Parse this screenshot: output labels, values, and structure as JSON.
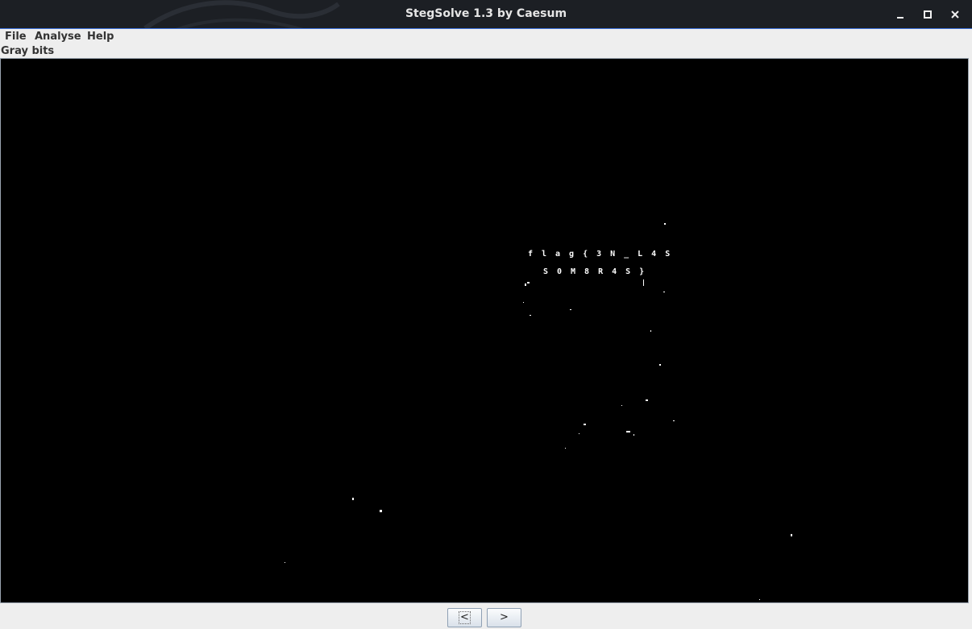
{
  "window": {
    "title": "StegSolve 1.3 by Caesum",
    "controls": {
      "minimize": "‗",
      "maximize": "□",
      "close": "✕"
    }
  },
  "menu": {
    "items": [
      {
        "label": "File"
      },
      {
        "label": "Analyse"
      },
      {
        "label": "Help"
      }
    ]
  },
  "status": {
    "plane_label": "Gray bits"
  },
  "image": {
    "hidden_text_line1": "flag{3N_L4S",
    "hidden_text_line2": "S0M8R4S}",
    "background": "#000000",
    "foreground": "#ffffff"
  },
  "navigation": {
    "prev_label": "<",
    "next_label": ">"
  },
  "colors": {
    "titlebar": "#1c1f24",
    "accent_border": "#3a6fd8",
    "window_bg": "#eeeeee"
  }
}
